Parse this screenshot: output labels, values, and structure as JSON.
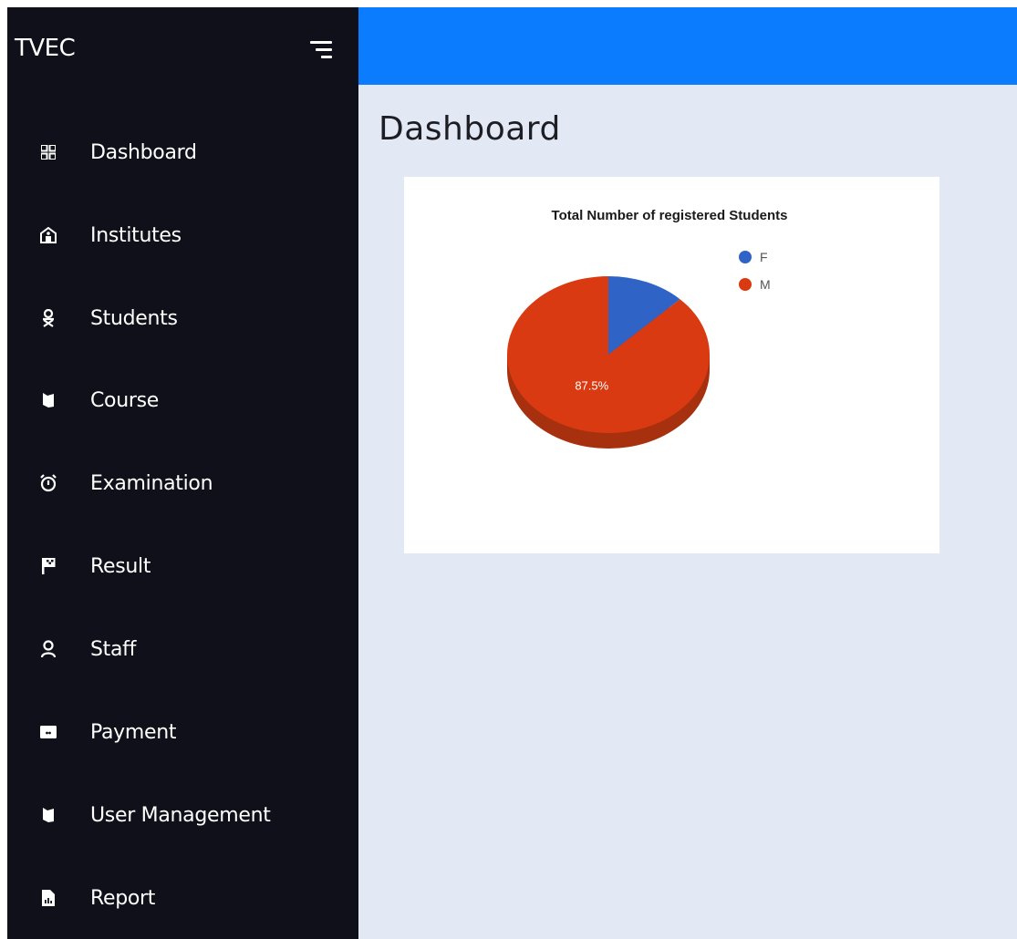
{
  "app": {
    "title": "TVEC"
  },
  "sidebar": {
    "items": [
      {
        "label": "Dashboard",
        "icon": "dashboard-grid-icon"
      },
      {
        "label": "Institutes",
        "icon": "institute-building-icon"
      },
      {
        "label": "Students",
        "icon": "student-icon"
      },
      {
        "label": "Course",
        "icon": "book-icon"
      },
      {
        "label": "Examination",
        "icon": "alarm-clock-icon"
      },
      {
        "label": "Result",
        "icon": "checkered-flag-icon"
      },
      {
        "label": "Staff",
        "icon": "person-icon"
      },
      {
        "label": "Payment",
        "icon": "payment-card-icon"
      },
      {
        "label": "User Management",
        "icon": "book-icon"
      },
      {
        "label": "Report",
        "icon": "report-file-icon"
      }
    ]
  },
  "main": {
    "page_title": "Dashboard"
  },
  "colors": {
    "sidebar_bg": "#10101a",
    "topbar": "#0a7cfd",
    "content_bg": "#e3e8f5",
    "series_f": "#2f63c5",
    "series_m": "#d93a12",
    "series_m_shadow": "#a7300f"
  },
  "chart_data": {
    "type": "pie",
    "title": "Total Number of registered Students",
    "legend_position": "top-right",
    "categories": [
      "F",
      "M"
    ],
    "values": [
      12.5,
      87.5
    ],
    "data_labels": [
      "",
      "87.5%"
    ]
  }
}
